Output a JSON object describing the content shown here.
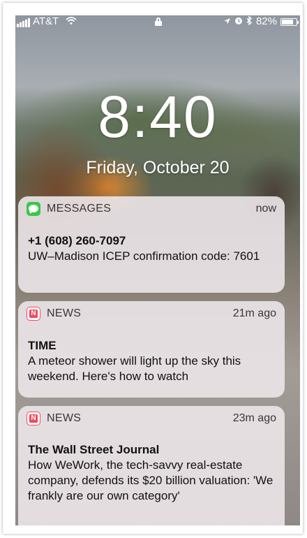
{
  "status_bar": {
    "carrier": "AT&T",
    "battery_percent": "82%",
    "battery_level": 0.82,
    "icons": [
      "signal-icon",
      "wifi-icon",
      "lock-icon",
      "location-icon",
      "alarm-icon",
      "bluetooth-icon",
      "battery-icon"
    ]
  },
  "lock_screen": {
    "time": "8:40",
    "date": "Friday, October 20"
  },
  "notifications": [
    {
      "app": "MESSAGES",
      "icon": "messages-icon",
      "time": "now",
      "title": "+1 (608) 260-7097",
      "body": "UW–Madison ICEP confirmation code: 7601"
    },
    {
      "app": "NEWS",
      "icon": "news-icon",
      "time": "21m ago",
      "title": "TIME",
      "body": "A meteor shower will light up the sky this weekend. Here's how to watch"
    },
    {
      "app": "NEWS",
      "icon": "news-icon",
      "time": "23m ago",
      "title": "The Wall Street Journal",
      "body": "How WeWork, the tech-savvy real-estate company, defends its $20 billion valuation: 'We frankly are our own category'"
    }
  ],
  "colors": {
    "messages_green": "#35c84a",
    "news_red": "#f04a5c",
    "card_background": "#ece6e9"
  }
}
